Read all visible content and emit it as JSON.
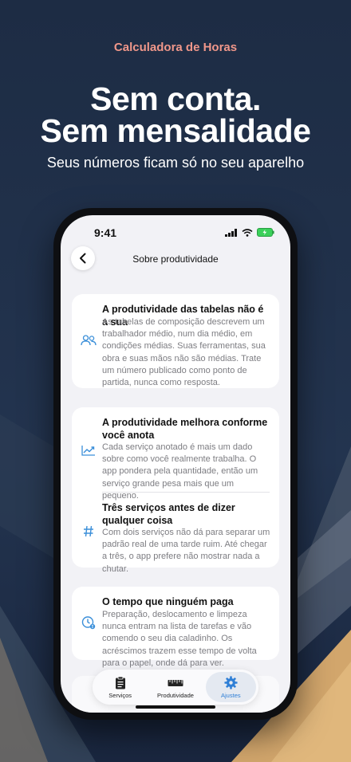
{
  "app_name": "Calculadora de Horas",
  "headline": {
    "line1": "Sem conta.",
    "line2": "Sem mensalidade"
  },
  "subheadline": "Seus números ficam só no seu aparelho",
  "status_bar": {
    "time": "9:41"
  },
  "nav": {
    "title": "Sobre produtividade"
  },
  "cards": [
    {
      "items": [
        {
          "icon": "people-icon",
          "title": "A produtividade das tabelas não é a sua",
          "body": "As tabelas de composição descrevem um trabalhador médio, num dia médio, em condições médias. Suas ferramentas, sua obra e suas mãos não são médias. Trate um número publicado como ponto de partida, nunca como resposta."
        }
      ]
    },
    {
      "items": [
        {
          "icon": "trend-up-icon",
          "title": "A produtividade melhora conforme você anota",
          "body": "Cada serviço anotado é mais um dado sobre como você realmente trabalha. O app pondera pela quantidade, então um serviço grande pesa mais que um pequeno."
        },
        {
          "icon": "hashtag-icon",
          "title": "Três serviços antes de dizer qualquer coisa",
          "body": "Com dois serviços não dá para separar um padrão real de uma tarde ruim. Até chegar a três, o app prefere não mostrar nada a chutar."
        }
      ]
    },
    {
      "items": [
        {
          "icon": "clock-alert-icon",
          "title": "O tempo que ninguém paga",
          "body": "Preparação, deslocamento e limpeza nunca entram na lista de tarefas e vão comendo o seu dia caladinho. Os acréscimos trazem esse tempo de volta para o papel, onde dá para ver."
        }
      ]
    }
  ],
  "tabbar": {
    "tabs": [
      {
        "label": "Serviços",
        "icon": "clipboard-icon"
      },
      {
        "label": "Produtividade",
        "icon": "ruler-icon"
      },
      {
        "label": "Ajustes",
        "icon": "gear-icon"
      }
    ],
    "active": "Ajustes"
  },
  "colors": {
    "accent": "#f0978a",
    "background": "#1f2f47",
    "icon_blue": "#3b8fd9"
  }
}
